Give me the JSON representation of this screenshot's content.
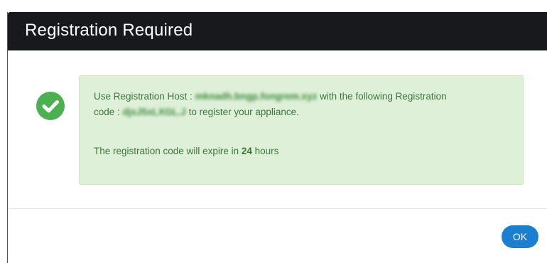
{
  "dialog": {
    "title": "Registration Required"
  },
  "message": {
    "line1_prefix": "Use Registration Host : ",
    "host_redacted": "mknadh.bngp.fongrem.xyz",
    "line1_suffix": " with the following Registration",
    "line2_prefix": "code : ",
    "code_redacted": "djsJ5xLXGL.J",
    "line2_suffix": " to register your appliance.",
    "expiry_prefix": "The registration code will expire in ",
    "expiry_hours": "24",
    "expiry_suffix": " hours"
  },
  "icons": {
    "status": "check-circle-icon"
  },
  "colors": {
    "header_bg": "#17191c",
    "alert_bg": "#dff0d8",
    "alert_text": "#3c763d",
    "success_icon": "#4caf50",
    "button_bg": "#1a7fd1"
  },
  "footer": {
    "ok_label": "OK"
  }
}
